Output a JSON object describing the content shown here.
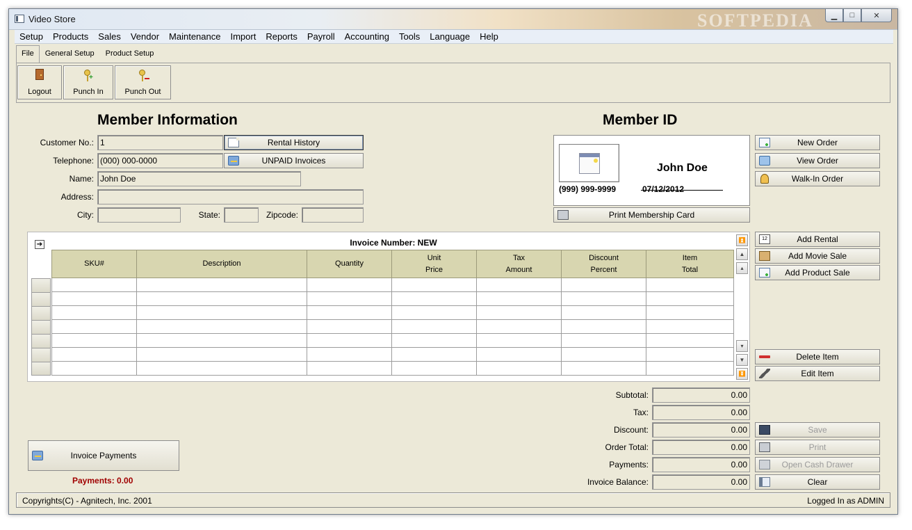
{
  "window": {
    "title": "Video Store",
    "watermark": "SOFTPEDIA"
  },
  "menu": [
    "Setup",
    "Products",
    "Sales",
    "Vendor",
    "Maintenance",
    "Import",
    "Reports",
    "Payroll",
    "Accounting",
    "Tools",
    "Language",
    "Help"
  ],
  "tabs": [
    "File",
    "General Setup",
    "Product Setup"
  ],
  "toolbar": {
    "logout": "Logout",
    "punch_in": "Punch In",
    "punch_out": "Punch Out"
  },
  "member_info": {
    "heading": "Member Information",
    "customer_no_label": "Customer No.:",
    "customer_no": "1",
    "telephone_label": "Telephone:",
    "telephone": "(000) 000-0000",
    "name_label": "Name:",
    "name": "John Doe",
    "address_label": "Address:",
    "address": "",
    "city_label": "City:",
    "city": "",
    "state_label": "State:",
    "state": "",
    "zipcode_label": "Zipcode:",
    "zipcode": "",
    "rental_history": "Rental History",
    "unpaid_invoices": "UNPAID Invoices"
  },
  "member_id": {
    "heading": "Member ID",
    "name": "John Doe",
    "phone": "(999) 999-9999",
    "date": "07/12/2012",
    "print_card": "Print Membership Card"
  },
  "order_buttons": {
    "new_order": "New Order",
    "view_order": "View Order",
    "walk_in_order": "Walk-In Order"
  },
  "item_buttons": {
    "add_rental": "Add Rental",
    "add_movie_sale": "Add Movie Sale",
    "add_product_sale": "Add Product Sale",
    "delete_item": "Delete Item",
    "edit_item": "Edit Item"
  },
  "invoice": {
    "title": "Invoice Number: NEW",
    "columns": [
      {
        "l1": "SKU#",
        "l2": ""
      },
      {
        "l1": "Description",
        "l2": ""
      },
      {
        "l1": "Quantity",
        "l2": ""
      },
      {
        "l1": "Unit",
        "l2": "Price"
      },
      {
        "l1": "Tax",
        "l2": "Amount"
      },
      {
        "l1": "Discount",
        "l2": "Percent"
      },
      {
        "l1": "Item",
        "l2": "Total"
      }
    ]
  },
  "totals": {
    "subtotal_label": "Subtotal:",
    "subtotal": "0.00",
    "tax_label": "Tax:",
    "tax": "0.00",
    "discount_label": "Discount:",
    "discount": "0.00",
    "order_total_label": "Order Total:",
    "order_total": "0.00",
    "payments_label": "Payments:",
    "payments": "0.00",
    "balance_label": "Invoice Balance:",
    "balance": "0.00"
  },
  "actions": {
    "save": "Save",
    "print": "Print",
    "open_cash_drawer": "Open Cash Drawer",
    "clear": "Clear"
  },
  "payments": {
    "button": "Invoice Payments",
    "summary": "Payments:  0.00"
  },
  "status": {
    "copyright": "Copyrights(C) - Agnitech, Inc. 2001",
    "logged_in": "Logged In as ADMIN"
  },
  "colors": {
    "window_bg": "#ece9d8",
    "grid_header": "#d8d6b0",
    "payments_red": "#a00000"
  }
}
